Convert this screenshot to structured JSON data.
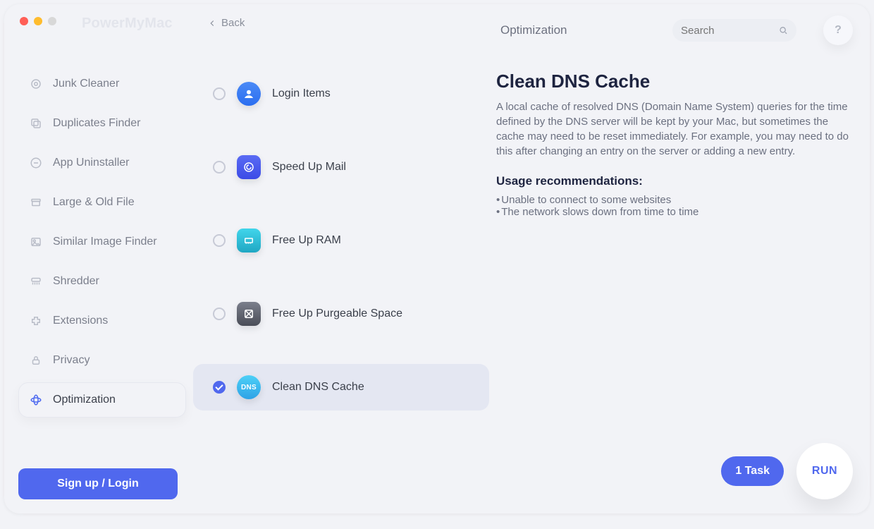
{
  "app": {
    "name": "PowerMyMac"
  },
  "header": {
    "back_label": "Back",
    "section_title": "Optimization",
    "search_placeholder": "Search",
    "help_label": "?"
  },
  "sidebar": {
    "items": [
      {
        "label": "Junk Cleaner"
      },
      {
        "label": "Duplicates Finder"
      },
      {
        "label": "App Uninstaller"
      },
      {
        "label": "Large & Old File"
      },
      {
        "label": "Similar Image Finder"
      },
      {
        "label": "Shredder"
      },
      {
        "label": "Extensions"
      },
      {
        "label": "Privacy"
      },
      {
        "label": "Optimization"
      }
    ],
    "signup_label": "Sign up / Login"
  },
  "tasks": {
    "items": [
      {
        "label": "Login Items",
        "checked": false,
        "icon": "login-icon"
      },
      {
        "label": "Speed Up Mail",
        "checked": false,
        "icon": "mail-icon"
      },
      {
        "label": "Free Up RAM",
        "checked": false,
        "icon": "ram-icon"
      },
      {
        "label": "Free Up Purgeable Space",
        "checked": false,
        "icon": "purgeable-icon"
      },
      {
        "label": "Clean DNS Cache",
        "checked": true,
        "icon": "dns-icon"
      }
    ]
  },
  "detail": {
    "title": "Clean DNS Cache",
    "description": "A local cache of resolved DNS (Domain Name System) queries for the time defined by the DNS server will be kept by your Mac, but sometimes the cache may need to be reset immediately. For example, you may need to do this after changing an entry on the server or adding a new entry.",
    "rec_title": "Usage recommendations:",
    "recommendations": [
      "Unable to connect to some websites",
      "The network slows down from time to time"
    ]
  },
  "footer": {
    "task_pill": "1 Task",
    "run_label": "RUN"
  }
}
